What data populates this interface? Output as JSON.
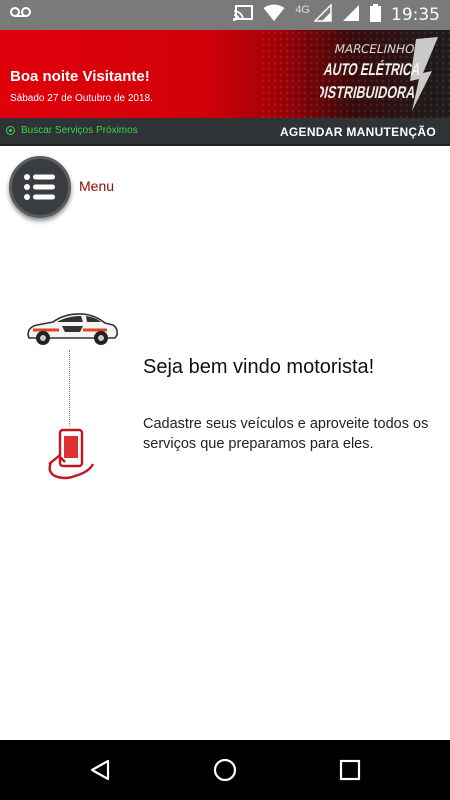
{
  "status_bar": {
    "time": "19:35",
    "network": "4G",
    "icons": [
      "voicemail-icon",
      "cast-icon",
      "wifi-icon",
      "signal-icon",
      "battery-icon"
    ]
  },
  "header": {
    "greeting": "Boa noite Visitante!",
    "date": "Sábado 27 de Outubro de 2018.",
    "logo": {
      "line1": "MARCELINHO",
      "line2": "AUTO ELÉTRICA",
      "line3": "DISTRIBUIDORA"
    }
  },
  "sub_bar": {
    "nearby_services": "Buscar Serviços Próximos",
    "schedule_maintenance": "AGENDAR MANUTENÇÃO"
  },
  "menu": {
    "label": "Menu"
  },
  "welcome": {
    "title": "Seja bem vindo motorista!",
    "text": "Cadastre seus veículos e aproveite todos os serviços que preparamos para eles."
  },
  "colors": {
    "brand_red": "#e0000b",
    "dark_bar": "#2f3336",
    "nearby_green": "#3ad24a",
    "menu_label": "#8a0d0d"
  }
}
